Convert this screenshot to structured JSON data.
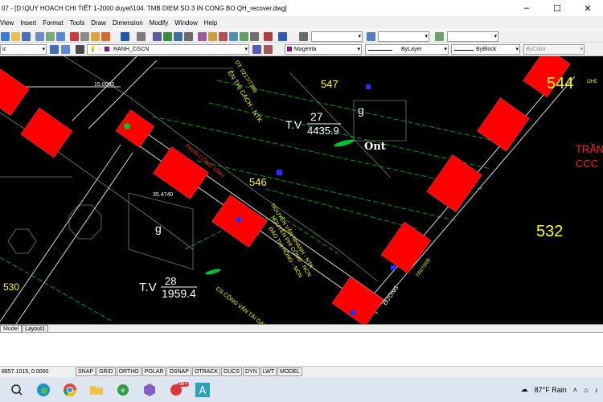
{
  "window": {
    "title": "07 - [D:\\QUY HOACH CHI TIẾT 1-2000 duyet\\104. TMB DIEM SO 3 IN CONG BO QH_recover.dwg]",
    "controls": {
      "minimize": "–",
      "maximize": "☐",
      "close": "✕"
    }
  },
  "menu": [
    "View",
    "Insert",
    "Format",
    "Tools",
    "Draw",
    "Dimension",
    "Modify",
    "Window",
    "Help"
  ],
  "properties": {
    "style_left": "ic",
    "layer": "RANH_CGCN",
    "color": "Magenta",
    "color_hex": "#c000c0",
    "linetype": "ByLayer",
    "lineweight": "ByBlock",
    "plotstyle": "ByColor"
  },
  "drawing": {
    "labels": {
      "lot_544": "544",
      "lot_547": "547",
      "lot_546": "546",
      "lot_532": "532",
      "lot_530": "530",
      "tv1_prefix": "T.V",
      "tv1_num": "27",
      "tv1_area": "4435.9",
      "tv2_prefix": "T.V",
      "tv2_num": "28",
      "tv2_area": "1959.4",
      "g1": "g",
      "g2": "g",
      "ont": "Ont",
      "dim_15": "15.0000",
      "dim_35": "35.4740",
      "tran": "TRẦN",
      "ccc": "CCC",
      "owner_nguyen": "NGUYỄN VĂN NHANH - NTK",
      "owner_phi": "NGUYỄN PHI CÔNG - NCN",
      "owner_dao": "ĐÀO THỊ HỒNG - NCN",
      "owner_cach": "ỄN THỊ CÁCH - NTK",
      "owner_phan": "PHAN CÔNG VĨNH",
      "owner_cs": "CS CÔNG VĂN TÀI GẠO",
      "phone": "DT: 0217/7389",
      "code_1": "7/0273/09",
      "ohe": "OHE",
      "road_label": "ĐƯỜNG"
    }
  },
  "layout_tabs": [
    "Model",
    "Layout1"
  ],
  "status": {
    "coords": "8857.1015, 0.0000",
    "buttons": [
      "SNAP",
      "GRID",
      "ORTHO",
      "POLAR",
      "OSNAP",
      "OTRACK",
      "DUCS",
      "DYN",
      "LWT",
      "MODEL"
    ]
  },
  "taskbar": {
    "weather": "87°F Rain",
    "icons": [
      "search-icon",
      "edge-icon",
      "chrome-icon",
      "folder-icon",
      "green-app-icon",
      "cube-app-icon",
      "badge-app-icon",
      "autocad-icon"
    ],
    "badge": "99+"
  }
}
